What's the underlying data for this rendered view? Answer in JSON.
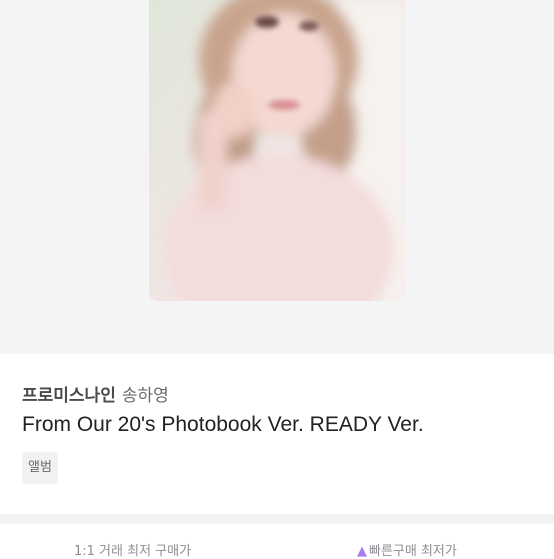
{
  "product": {
    "artist": "프로미스나인",
    "member": "송하영",
    "album": "From Our 20's Photobook Ver. READY Ver.",
    "category": "앨범"
  },
  "image": {
    "description": "photocard",
    "icon": "photocard-image"
  },
  "bottom_tabs": {
    "one_on_one": "1:1 거래 최저 구매가",
    "quick_buy": "빠른구매 최저가",
    "quick_icon": "lightning-icon",
    "accent_color": "#a67cf0"
  }
}
